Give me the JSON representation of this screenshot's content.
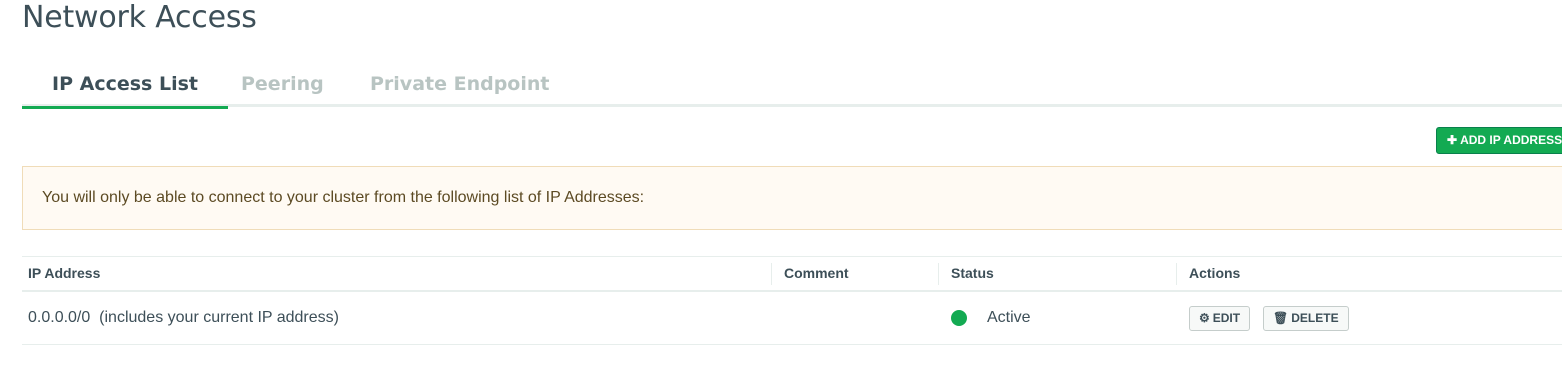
{
  "page": {
    "title": "Network Access"
  },
  "tabs": [
    {
      "label": "IP Access List",
      "active": true
    },
    {
      "label": "Peering",
      "active": false
    },
    {
      "label": "Private Endpoint",
      "active": false
    }
  ],
  "toolbar": {
    "add_ip_label": "ADD IP ADDRESS",
    "add_icon": "plus-icon"
  },
  "banner": {
    "text": "You will only be able to connect to your cluster from the following list of IP Addresses:"
  },
  "table": {
    "columns": [
      "IP Address",
      "Comment",
      "Status",
      "Actions"
    ],
    "rows": [
      {
        "ip_address": "0.0.0.0/0  (includes your current IP address)",
        "comment": "",
        "status": "Active",
        "status_color": "#13aa52",
        "actions": {
          "edit_label": "EDIT",
          "edit_icon": "gear-icon",
          "delete_label": "DELETE",
          "delete_icon": "trash-icon"
        }
      }
    ]
  },
  "colors": {
    "accent": "#13aa52",
    "banner_bg": "#fffaf3",
    "text": "#3d4f58",
    "tab_inactive": "#b8c4c2"
  }
}
